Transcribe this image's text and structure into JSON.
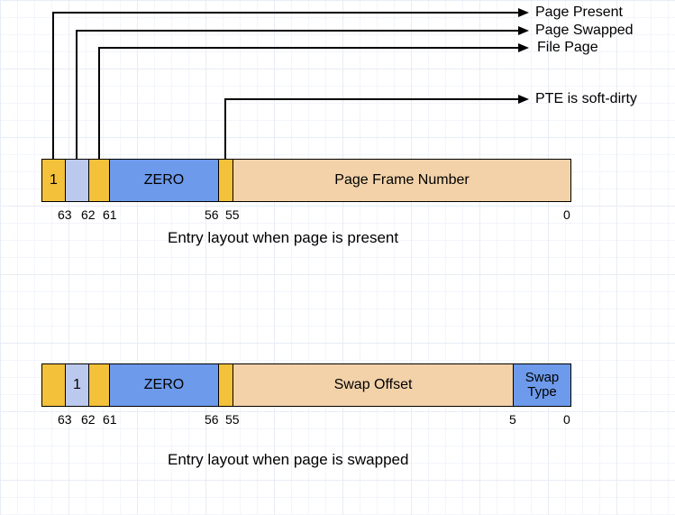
{
  "arrows": {
    "page_present": "Page Present",
    "page_swapped": "Page Swapped",
    "file_page": "File Page",
    "pte_soft_dirty": "PTE is soft-dirty"
  },
  "entry_present": {
    "bit63": "1",
    "bit62": "",
    "bit61": "",
    "zero": "ZERO",
    "bit55": "",
    "pfn": "Page Frame Number",
    "caption": "Entry layout when page is present",
    "bits": {
      "b63": "63",
      "b62": "62",
      "b61": "61",
      "b56": "56",
      "b55": "55",
      "b0": "0"
    }
  },
  "entry_swapped": {
    "bit63": "",
    "bit62": "1",
    "bit61": "",
    "zero": "ZERO",
    "bit55": "",
    "swap_offset": "Swap Offset",
    "swap_type": "Swap\nType",
    "caption": "Entry layout when page is swapped",
    "bits": {
      "b63": "63",
      "b62": "62",
      "b61": "61",
      "b56": "56",
      "b55": "55",
      "b5": "5",
      "b0": "0"
    }
  },
  "chart_data": {
    "type": "table",
    "title": "Linux /proc/pagemap entry layouts",
    "entries": [
      {
        "mode": "present",
        "fields": [
          {
            "name": "Page Present",
            "bits": "63",
            "value": 1
          },
          {
            "name": "Page Swapped",
            "bits": "62"
          },
          {
            "name": "File Page",
            "bits": "61"
          },
          {
            "name": "ZERO",
            "bits": "60-56"
          },
          {
            "name": "PTE is soft-dirty",
            "bits": "55"
          },
          {
            "name": "Page Frame Number",
            "bits": "54-0"
          }
        ]
      },
      {
        "mode": "swapped",
        "fields": [
          {
            "name": "Page Present",
            "bits": "63"
          },
          {
            "name": "Page Swapped",
            "bits": "62",
            "value": 1
          },
          {
            "name": "File Page",
            "bits": "61"
          },
          {
            "name": "ZERO",
            "bits": "60-56"
          },
          {
            "name": "PTE is soft-dirty",
            "bits": "55"
          },
          {
            "name": "Swap Offset",
            "bits": "54-5"
          },
          {
            "name": "Swap Type",
            "bits": "4-0"
          }
        ]
      }
    ]
  }
}
